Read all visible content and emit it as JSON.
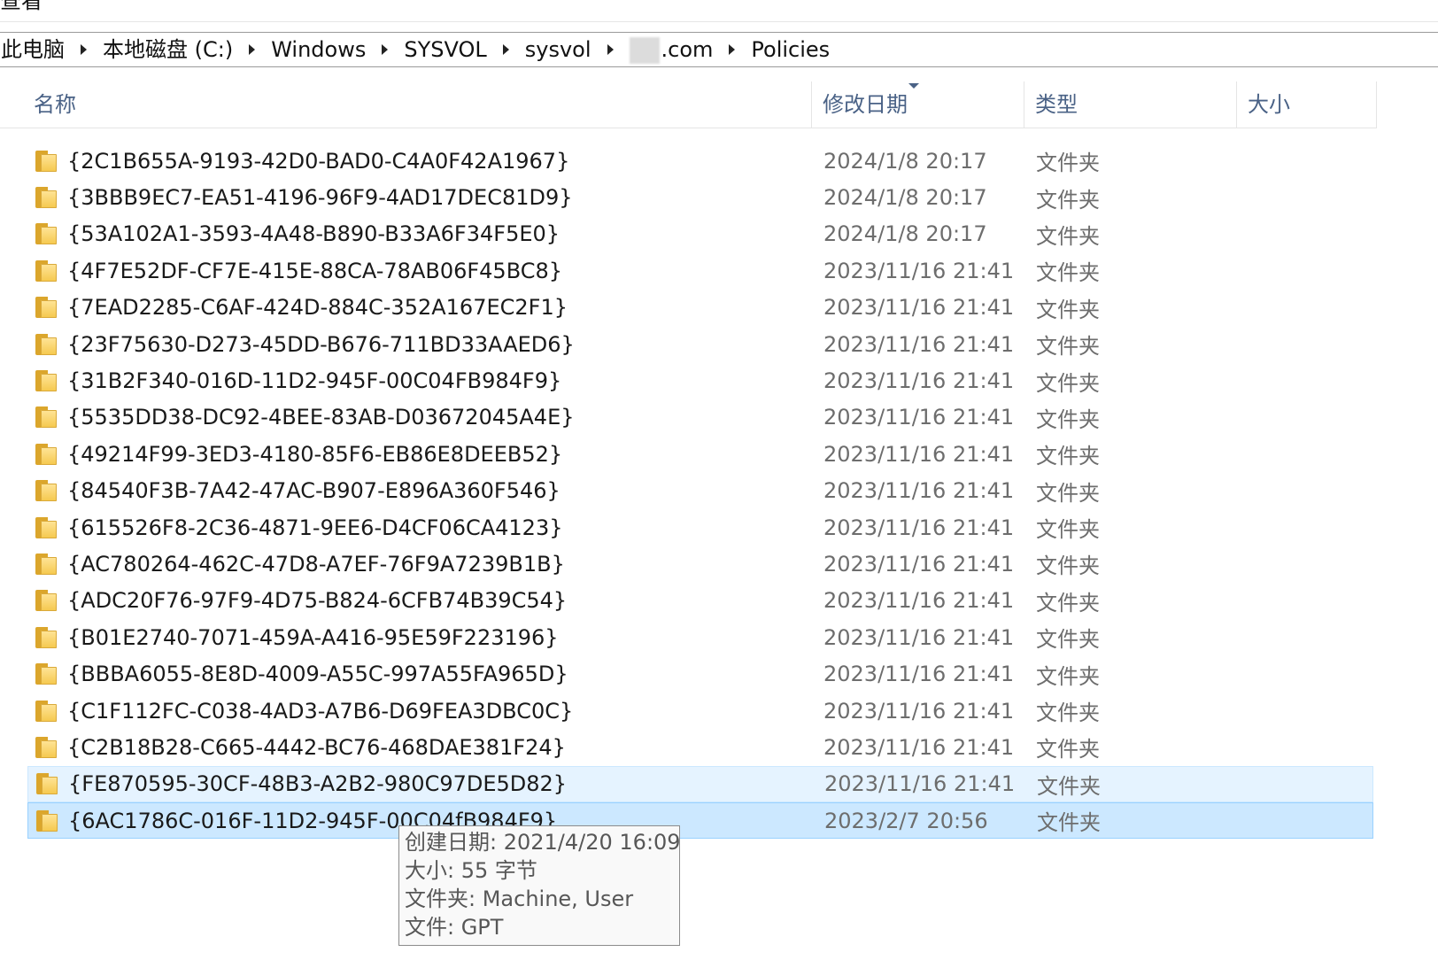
{
  "menu": {
    "fragment": "查看"
  },
  "breadcrumb": {
    "items": [
      "此电脑",
      "本地磁盘 (C:)",
      "Windows",
      "SYSVOL",
      "sysvol",
      ".com",
      "Policies"
    ]
  },
  "columns": {
    "name": "名称",
    "modified": "修改日期",
    "type": "类型",
    "size": "大小"
  },
  "rows": [
    {
      "name": "{2C1B655A-9193-42D0-BAD0-C4A0F42A1967}",
      "modified": "2024/1/8 20:17",
      "type": "文件夹"
    },
    {
      "name": "{3BBB9EC7-EA51-4196-96F9-4AD17DEC81D9}",
      "modified": "2024/1/8 20:17",
      "type": "文件夹"
    },
    {
      "name": "{53A102A1-3593-4A48-B890-B33A6F34F5E0}",
      "modified": "2024/1/8 20:17",
      "type": "文件夹"
    },
    {
      "name": "{4F7E52DF-CF7E-415E-88CA-78AB06F45BC8}",
      "modified": "2023/11/16 21:41",
      "type": "文件夹"
    },
    {
      "name": "{7EAD2285-C6AF-424D-884C-352A167EC2F1}",
      "modified": "2023/11/16 21:41",
      "type": "文件夹"
    },
    {
      "name": "{23F75630-D273-45DD-B676-711BD33AAED6}",
      "modified": "2023/11/16 21:41",
      "type": "文件夹"
    },
    {
      "name": "{31B2F340-016D-11D2-945F-00C04FB984F9}",
      "modified": "2023/11/16 21:41",
      "type": "文件夹"
    },
    {
      "name": "{5535DD38-DC92-4BEE-83AB-D03672045A4E}",
      "modified": "2023/11/16 21:41",
      "type": "文件夹"
    },
    {
      "name": "{49214F99-3ED3-4180-85F6-EB86E8DEEB52}",
      "modified": "2023/11/16 21:41",
      "type": "文件夹"
    },
    {
      "name": "{84540F3B-7A42-47AC-B907-E896A360F546}",
      "modified": "2023/11/16 21:41",
      "type": "文件夹"
    },
    {
      "name": "{615526F8-2C36-4871-9EE6-D4CF06CA4123}",
      "modified": "2023/11/16 21:41",
      "type": "文件夹"
    },
    {
      "name": "{AC780264-462C-47D8-A7EF-76F9A7239B1B}",
      "modified": "2023/11/16 21:41",
      "type": "文件夹"
    },
    {
      "name": "{ADC20F76-97F9-4D75-B824-6CFB74B39C54}",
      "modified": "2023/11/16 21:41",
      "type": "文件夹"
    },
    {
      "name": "{B01E2740-7071-459A-A416-95E59F223196}",
      "modified": "2023/11/16 21:41",
      "type": "文件夹"
    },
    {
      "name": "{BBBA6055-8E8D-4009-A55C-997A55FA965D}",
      "modified": "2023/11/16 21:41",
      "type": "文件夹"
    },
    {
      "name": "{C1F112FC-C038-4AD3-A7B6-D69FEA3DBC0C}",
      "modified": "2023/11/16 21:41",
      "type": "文件夹"
    },
    {
      "name": "{C2B18B28-C665-4442-BC76-468DAE381F24}",
      "modified": "2023/11/16 21:41",
      "type": "文件夹"
    },
    {
      "name": "{FE870595-30CF-48B3-A2B2-980C97DE5D82}",
      "modified": "2023/11/16 21:41",
      "type": "文件夹"
    },
    {
      "name": "{6AC1786C-016F-11D2-945F-00C04fB984F9}",
      "modified": "2023/2/7 20:56",
      "type": "文件夹"
    }
  ],
  "tooltip": {
    "created": "创建日期: 2021/4/20 16:09",
    "size": "大小: 55 字节",
    "folders": "文件夹: Machine, User",
    "files": "文件: GPT"
  }
}
